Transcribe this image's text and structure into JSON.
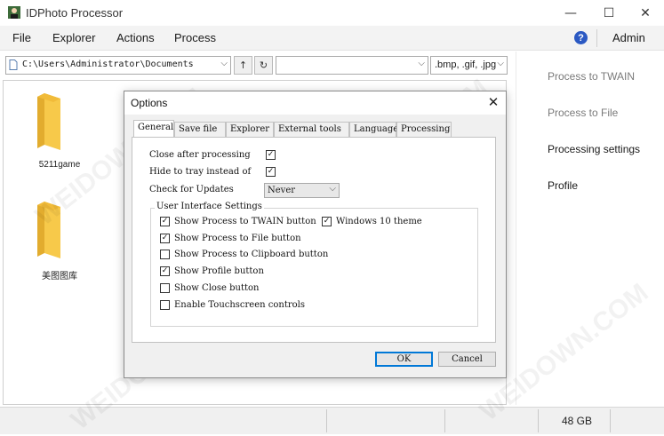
{
  "window": {
    "title": "IDPhoto Processor",
    "controls": {
      "minimize": "—",
      "maximize": "☐",
      "close": "✕"
    }
  },
  "menu": {
    "items": [
      "File",
      "Explorer",
      "Actions",
      "Process"
    ],
    "help_icon": "?",
    "admin": "Admin"
  },
  "toolbar": {
    "path": "C:\\Users\\Administrator\\Documents",
    "up_icon": "↑",
    "refresh_icon": "↻",
    "second_combo": "",
    "filter": ".bmp, .gif, .jpg"
  },
  "explorer": {
    "folders": [
      "5211game",
      "美图图库"
    ]
  },
  "right_panel": {
    "items": [
      {
        "label": "Process to TWAIN",
        "color": "#7a7a7a"
      },
      {
        "label": "Process to File",
        "color": "#7a7a7a"
      },
      {
        "label": "Processing settings",
        "color": "#1a1a1a"
      },
      {
        "label": "Profile",
        "color": "#1a1a1a"
      }
    ]
  },
  "status": {
    "size": "48 GB"
  },
  "dialog": {
    "title": "Options",
    "close_icon": "✕",
    "tabs": [
      "General",
      "Save file",
      "Explorer",
      "External tools",
      "Language",
      "Processing"
    ],
    "active_tab": "General",
    "options": {
      "close_after_processing": {
        "label": "Close after processing",
        "checked": true
      },
      "hide_to_tray": {
        "label": "Hide to tray instead of",
        "checked": true
      },
      "check_updates": {
        "label": "Check for Updates",
        "value": "Never"
      }
    },
    "group": {
      "title": "User Interface Settings",
      "items": [
        {
          "label": "Show Process to TWAIN button",
          "checked": true
        },
        {
          "label": "Show Process to File button",
          "checked": true
        },
        {
          "label": "Show Process to Clipboard button",
          "checked": false
        },
        {
          "label": "Show Profile button",
          "checked": true
        },
        {
          "label": "Show Close button",
          "checked": false
        },
        {
          "label": "Enable Touchscreen controls",
          "checked": false
        }
      ],
      "windows10": {
        "label": "Windows 10 theme",
        "checked": true
      }
    },
    "buttons": {
      "ok": "OK",
      "cancel": "Cancel"
    }
  },
  "watermark": "WEIDOWN.COM",
  "colors": {
    "accent": "#0078d7",
    "help": "#2b59c3",
    "folder": "#f5c342"
  }
}
